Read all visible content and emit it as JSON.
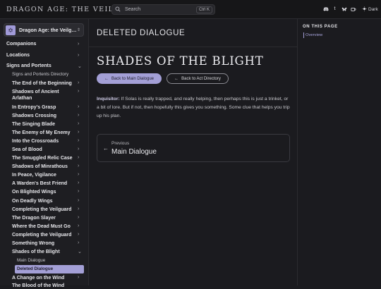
{
  "header": {
    "site_title": "DRAGON AGE: THE VEILGUARD",
    "search_placeholder": "Search",
    "search_shortcut": "Ctrl K",
    "social_icons": [
      "discord-icon",
      "tumblr-icon",
      "bluesky-icon",
      "kofi-icon"
    ],
    "theme_label": "Dark"
  },
  "sidebar": {
    "guide_name": "Dragon Age: the Veilg…",
    "sections": [
      "Companions",
      "Locations",
      "Signs and Portents"
    ],
    "directory_label": "Signs and Portents Directory",
    "items": [
      "The End of the Beginning",
      "Shadows of Ancient Arlathan",
      "In Entropy's Grasp",
      "Shadows Crossing",
      "The Singing Blade",
      "The Enemy of My Enemy",
      "Into the Crossroads",
      "Sea of Blood",
      "The Smuggled Relic Case",
      "Shadows of Minrathous",
      "In Peace, Vigilance",
      "A Warden's Best Friend",
      "On Blighted Wings",
      "On Deadly Wings",
      "Completing the Veilguard",
      "The Dragon Slayer",
      "Where the Dead Must Go",
      "Completing the Veilguard",
      "Something Wrong",
      "Shades of the Blight"
    ],
    "leaf_main": "Main Dialogue",
    "leaf_active": "Deleted Dialogue",
    "after_item": "A Change on the Wind",
    "cut_item": "The Blood of the Wind"
  },
  "main": {
    "eyebrow": "DELETED DIALOGUE",
    "title": "SHADES OF THE BLIGHT",
    "btn_main": "Back to Main Dialogue",
    "btn_act": "Back to Act Directory",
    "speaker": "Inquisitor:",
    "dialogue_text": " If Solas is really trapped, and really helping, then perhaps this is just a trinket, or a bit of lore. But if not, then hopefully this gives you something. Some clue that helps you trip up his plan.",
    "prev_label": "Previous",
    "prev_title": "Main Dialogue"
  },
  "toc": {
    "title": "ON THIS PAGE",
    "link": "Overview"
  },
  "colors": {
    "accent": "#a39fd6",
    "background": "#1b1b1f",
    "sidebar_bg": "#1e1e22"
  }
}
